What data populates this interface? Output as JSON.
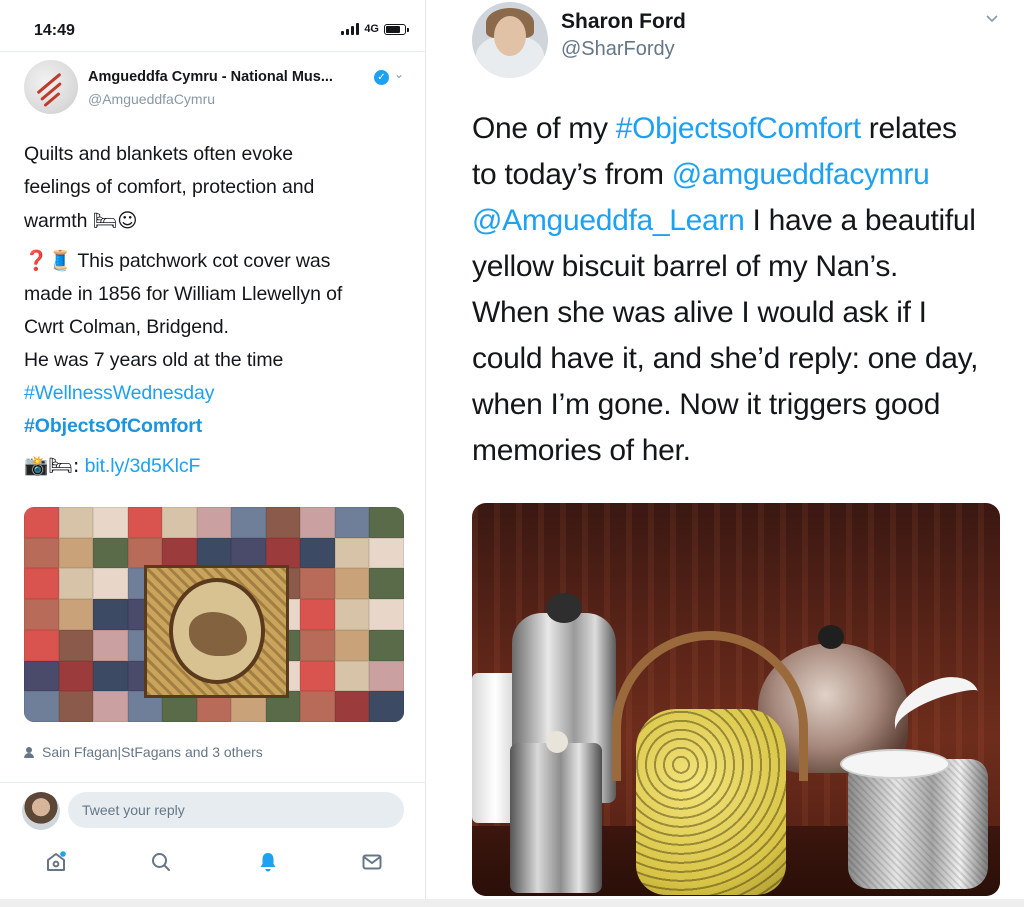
{
  "left": {
    "status_bar": {
      "time": "14:49",
      "network": "4G"
    },
    "tweet": {
      "account_name": "Amgueddfa Cymru - National Mus...",
      "account_handle": "@AmgueddfaCymru",
      "text_lines": [
        "Quilts and blankets often evoke",
        "feelings of comfort, protection and",
        "warmth"
      ],
      "line4_emoji": "❓🧵",
      "line4_text": "This patchwork cot cover was",
      "body_lines": [
        "made in 1856 for William Llewellyn of",
        "Cwrt Colman, Bridgend.",
        "He was 7 years old at the time"
      ],
      "hashtag_1": "#WellnessWednesday",
      "hashtag_2": "#ObjectsOfComfort",
      "link_prefix": "📸🛏:",
      "link_text": "bit.ly/3d5KlcF",
      "warmth_emoji": "🛏☺"
    },
    "likes_text": "Sain Ffagan|StFagans and 3 others",
    "reply_placeholder": "Tweet your reply",
    "nav": [
      "home-icon",
      "search-icon",
      "notifications-icon",
      "messages-icon"
    ]
  },
  "right": {
    "name": "Sharon Ford",
    "handle": "@SharFordy",
    "body": {
      "l1_a": "One of my ",
      "l1_link": "#ObjectsofComfort",
      "l1_b": " relates",
      "l2_a": "to today’s from ",
      "l2_link": "@amgueddfacymru",
      "l3_link": "@Amgueddfa_Learn",
      "l3_b": " I have a beautiful",
      "l4": "yellow biscuit barrel of my Nan’s.",
      "l5": "When she was alive I would ask if I",
      "l6": "could have it, and she’d reply: one day,",
      "l7": "when I’m gone. Now it triggers good",
      "l8": "memories of her."
    }
  },
  "colors": {
    "link": "#1da1f2",
    "text": "#14171a",
    "muted": "#657786",
    "notification_active": "#1da1f2"
  }
}
